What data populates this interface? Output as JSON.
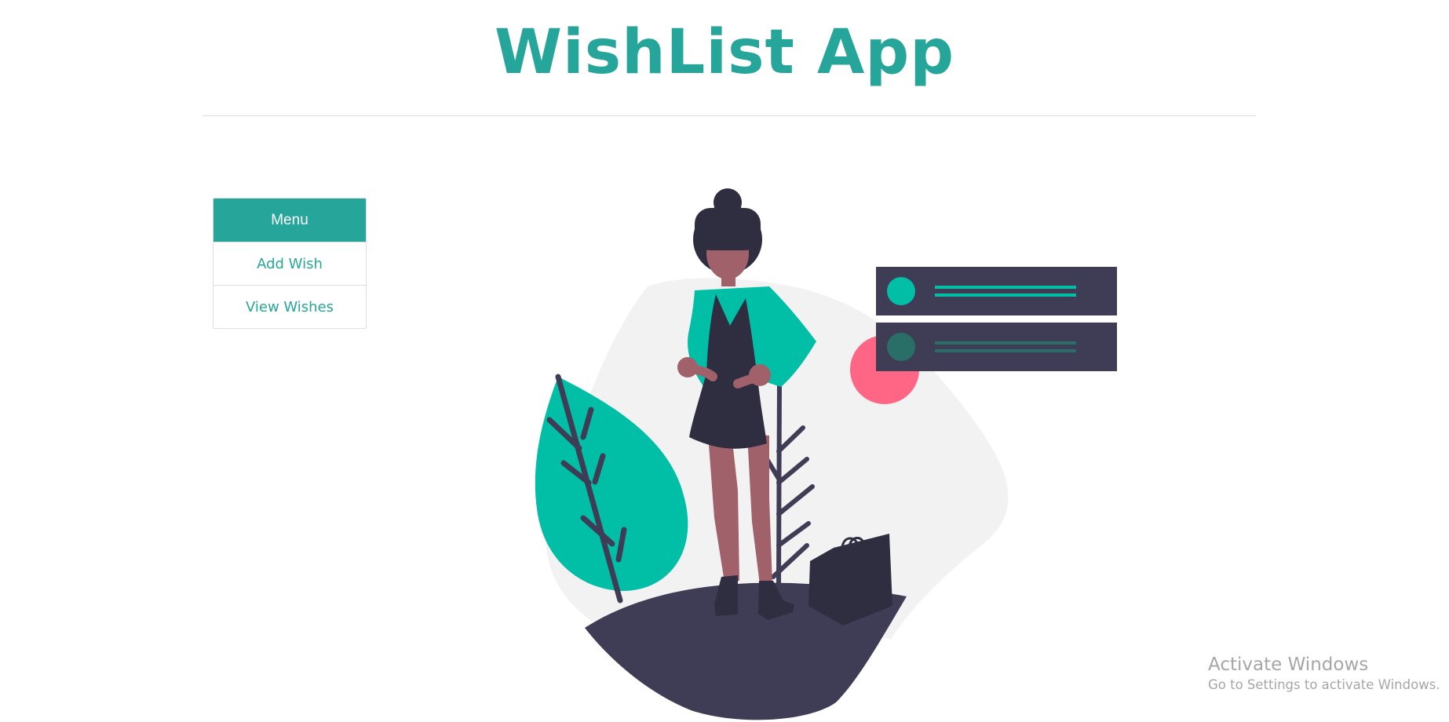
{
  "app": {
    "title": "WishList App"
  },
  "menu": {
    "header": "Menu",
    "items": [
      {
        "label": "Add Wish"
      },
      {
        "label": "View Wishes"
      }
    ]
  },
  "colors": {
    "brand": "#26a69a",
    "illustration_teal": "#00bfa6",
    "illustration_dark": "#3f3d56",
    "illustration_pink": "#ff6584",
    "illustration_skin": "#a0616a",
    "background_blob": "#f2f2f2"
  },
  "watermark": {
    "title": "Activate Windows",
    "subtitle": "Go to Settings to activate Windows."
  }
}
